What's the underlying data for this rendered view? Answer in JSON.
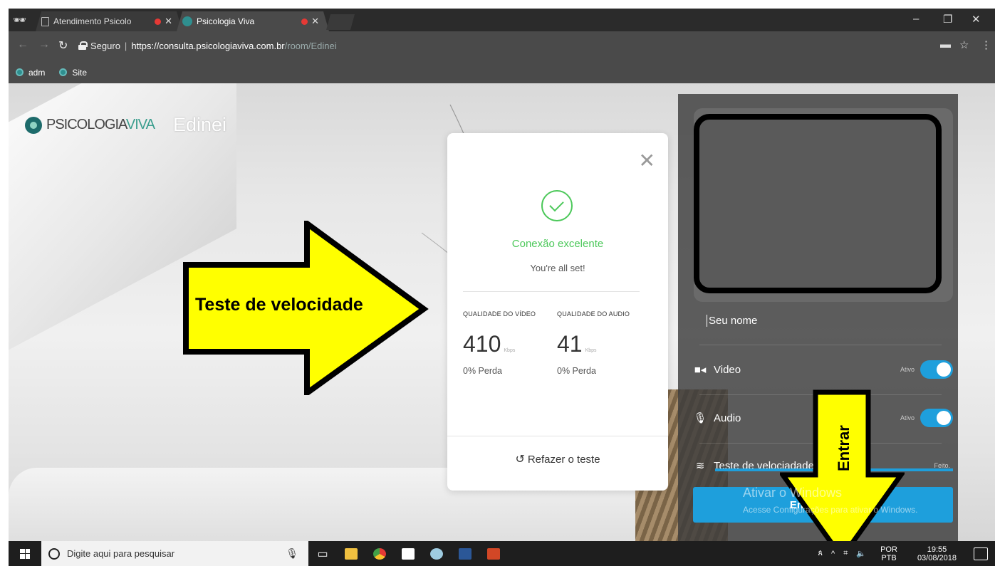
{
  "browser": {
    "tabs": [
      {
        "title": "Atendimento Psicolo",
        "close": "✕"
      },
      {
        "title": "Psicologia Viva",
        "close": "✕"
      }
    ],
    "window_controls": {
      "minimize": "–",
      "restore": "❐",
      "close": "✕"
    },
    "address": {
      "secure_label": "Seguro",
      "host": "https://consulta.psicologiaviva.com.br",
      "path": "/room/Edinei"
    },
    "bookmarks": [
      {
        "label": "adm"
      },
      {
        "label": "Site"
      }
    ]
  },
  "page": {
    "brand": {
      "part1": "PSICOLOGIA",
      "part2": "VIVA"
    },
    "room_name": "Edinei"
  },
  "annotations": {
    "arrow_left": "Teste de velocidade",
    "arrow_down": "Entrar",
    "arrow_color": "#ffff00"
  },
  "speed_card": {
    "status_title": "Conexão excelente",
    "status_sub": "You're all set!",
    "video": {
      "label": "QUALIDADE DO VÍDEO",
      "value": "410",
      "unit": "Kbps",
      "loss": "0% Perda"
    },
    "audio": {
      "label": "QUALIDADE DO AUDIO",
      "value": "41",
      "unit": "Kbps",
      "loss": "0% Perda"
    },
    "redo_label": "Refazer o teste"
  },
  "panel": {
    "name_label": "Seu nome",
    "video": {
      "label": "Video",
      "status": "Ativo"
    },
    "audio": {
      "label": "Audio",
      "status": "Ativo"
    },
    "speed": {
      "label": "Teste de velociadade",
      "status": "Feito."
    },
    "enter_button": "Entrar Edinei",
    "accent": "#1e9fdc"
  },
  "watermark": {
    "line1": "Ativar o Windows",
    "line2": "Acesse Configurações para ativar o Windows."
  },
  "taskbar": {
    "search_placeholder": "Digite aqui para pesquisar",
    "lang_top": "POR",
    "lang_bottom": "PTB",
    "time": "19:55",
    "date": "03/08/2018"
  }
}
